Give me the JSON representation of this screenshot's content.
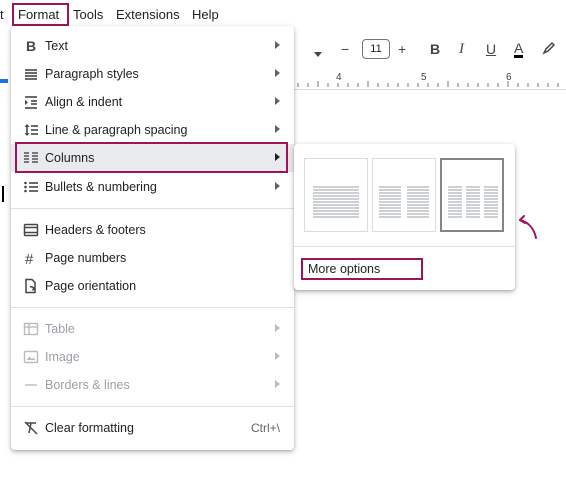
{
  "menubar": {
    "items": [
      {
        "label": "t"
      },
      {
        "label": "Format"
      },
      {
        "label": "Tools"
      },
      {
        "label": "Extensions"
      },
      {
        "label": "Help"
      }
    ]
  },
  "toolbar": {
    "font_size": "11",
    "minus": "−",
    "plus": "+",
    "bold": "B",
    "italic": "I",
    "underline": "U",
    "text_color": "A"
  },
  "ruler": {
    "marks": [
      "4",
      "5",
      "6"
    ]
  },
  "format_menu": {
    "items": [
      {
        "label": "Text",
        "icon": "bold-icon",
        "submenu": true
      },
      {
        "label": "Paragraph styles",
        "icon": "paragraph-styles-icon",
        "submenu": true
      },
      {
        "label": "Align & indent",
        "icon": "align-indent-icon",
        "submenu": true
      },
      {
        "label": "Line & paragraph spacing",
        "icon": "line-spacing-icon",
        "submenu": true
      },
      {
        "label": "Columns",
        "icon": "columns-icon",
        "submenu": true,
        "active": true
      },
      {
        "label": "Bullets & numbering",
        "icon": "bullets-icon",
        "submenu": true
      },
      {
        "label": "Headers & footers",
        "icon": "headers-footers-icon"
      },
      {
        "label": "Page numbers",
        "icon": "hash-icon"
      },
      {
        "label": "Page orientation",
        "icon": "page-orientation-icon"
      },
      {
        "label": "Table",
        "icon": "table-icon",
        "submenu": true,
        "disabled": true
      },
      {
        "label": "Image",
        "icon": "image-icon",
        "submenu": true,
        "disabled": true
      },
      {
        "label": "Borders & lines",
        "icon": "borders-lines-icon",
        "submenu": true,
        "disabled": true
      },
      {
        "label": "Clear formatting",
        "icon": "clear-formatting-icon",
        "shortcut": "Ctrl+\\"
      }
    ]
  },
  "columns_submenu": {
    "options": [
      {
        "columns": 1
      },
      {
        "columns": 2
      },
      {
        "columns": 3,
        "selected": true
      }
    ],
    "more_options": "More options"
  },
  "colors": {
    "highlight": "#a0125e",
    "active_row": "#e8eaed",
    "disabled_text": "#9aa0a6"
  }
}
